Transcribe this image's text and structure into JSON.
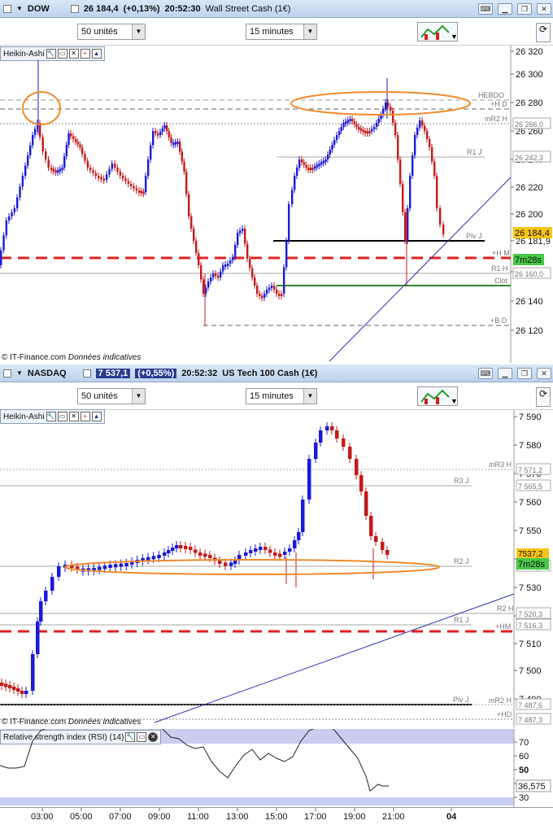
{
  "panel1": {
    "symbol": "DOW",
    "price": "26 184,4",
    "change": "(+0,13%)",
    "time": "20:52:30",
    "name": "Wall Street Cash (1€)",
    "units": "50 unités",
    "interval": "15 minutes",
    "chart_type": "Heikin-Ashi",
    "credit": "© IT-Finance.com",
    "credit_note": "Données indicatives",
    "price_tag": "26 184,4",
    "countdown": "7m28s",
    "y_ticks": [
      "26 320",
      "26 300",
      "26 280",
      "26 260",
      "26 240",
      "26 220",
      "26 200",
      "26 181,9",
      "26 160",
      "26 140",
      "26 120"
    ],
    "levels": [
      {
        "label": "HEBDO",
        "value": "26 276"
      },
      {
        "label": "+H D",
        "value": ""
      },
      {
        "label": "mR2 H",
        "value": "26 266,0"
      },
      {
        "label": "R1 J",
        "value": "26 242,3"
      },
      {
        "label": "Piv J",
        "value": ""
      },
      {
        "label": "+H M",
        "value": ""
      },
      {
        "label": "R1 H",
        "value": "26 160,0"
      },
      {
        "label": "Clot",
        "value": ""
      },
      {
        "label": "+B D",
        "value": ""
      }
    ]
  },
  "panel2": {
    "symbol": "NASDAQ",
    "price": "7 537,1",
    "change": "(+0,55%)",
    "time": "20:52:32",
    "name": "US Tech 100 Cash (1€)",
    "units": "50 unités",
    "interval": "15 minutes",
    "chart_type": "Heikin-Ashi",
    "credit": "© IT-Finance.com",
    "credit_note": "Données indicatives",
    "price_tag": "7537,2",
    "countdown": "7m28s",
    "y_ticks": [
      "7 590",
      "7 580",
      "7 570",
      "7 560",
      "7 550",
      "7 540",
      "7 530",
      "7 520",
      "7 510",
      "7 500",
      "7 490"
    ],
    "levels": [
      {
        "label": "mR3 H",
        "value": "7 571,2"
      },
      {
        "label": "R3 J",
        "value": "7 565,5"
      },
      {
        "label": "R2 J",
        "value": "7 536,0"
      },
      {
        "label": "R2 H",
        "value": "7 520,3"
      },
      {
        "label": "R1 J",
        "value": "7 516,3"
      },
      {
        "label": "+HM",
        "value": ""
      },
      {
        "label": "Piv J",
        "value": ""
      },
      {
        "label": "mR2 H",
        "value": "7 487,6"
      },
      {
        "label": "+HD",
        "value": "7 487,3"
      }
    ]
  },
  "rsi": {
    "title": "Relative strength index (RSI) (14)",
    "ticks": [
      "70",
      "60",
      "50",
      "40",
      "30"
    ],
    "value": "36,575"
  },
  "time_axis": [
    "03:00",
    "05:00",
    "07:00",
    "09:00",
    "11:00",
    "13:00",
    "15:00",
    "17:00",
    "19:00",
    "21:00",
    "04"
  ],
  "colors": {
    "up": "#1a1adb",
    "down": "#c41a1a",
    "pivot": "#000000",
    "hm": "#e02020",
    "ellipse": "#f08a2c",
    "trend": "#3030b0",
    "clot": "#2a8a2a",
    "rsi_band": "#c9cdf0"
  },
  "chart_data": [
    {
      "type": "candlestick",
      "subtype": "heikin-ashi",
      "series": [
        {
          "name": "Wall Street Cash (1€)"
        }
      ],
      "x": [
        "02:00",
        "03:00",
        "04:00",
        "05:00",
        "06:00",
        "07:00",
        "08:00",
        "09:00",
        "10:00",
        "11:00",
        "12:00",
        "13:00",
        "14:00",
        "15:00",
        "16:00",
        "17:00",
        "18:00",
        "19:00",
        "20:00",
        "20:30",
        "20:52"
      ],
      "close": [
        26175,
        26255,
        26240,
        26250,
        26240,
        26235,
        26235,
        26262,
        26240,
        26190,
        26170,
        26170,
        26140,
        26145,
        26195,
        26235,
        26250,
        26265,
        26262,
        26200,
        26184.4
      ],
      "ylim": [
        26110,
        26325
      ]
    },
    {
      "type": "candlestick",
      "subtype": "heikin-ashi",
      "series": [
        {
          "name": "US Tech 100 Cash (1€)"
        }
      ],
      "x": [
        "02:00",
        "03:00",
        "04:00",
        "05:00",
        "06:00",
        "07:00",
        "08:00",
        "09:00",
        "10:00",
        "11:00",
        "12:00",
        "13:00",
        "14:00",
        "15:00",
        "16:00",
        "17:00",
        "18:00",
        "19:00",
        "20:00",
        "20:30",
        "20:52"
      ],
      "close": [
        7498,
        7500,
        7525,
        7536,
        7537,
        7536,
        7538,
        7540,
        7541,
        7541,
        7539,
        7538,
        7540,
        7542,
        7545,
        7560,
        7588,
        7580,
        7565,
        7545,
        7537.1
      ],
      "ylim": [
        7485,
        7592
      ]
    },
    {
      "type": "line",
      "series": [
        {
          "name": "RSI (14)"
        }
      ],
      "last": 36.575,
      "ylim": [
        30,
        75
      ]
    }
  ]
}
